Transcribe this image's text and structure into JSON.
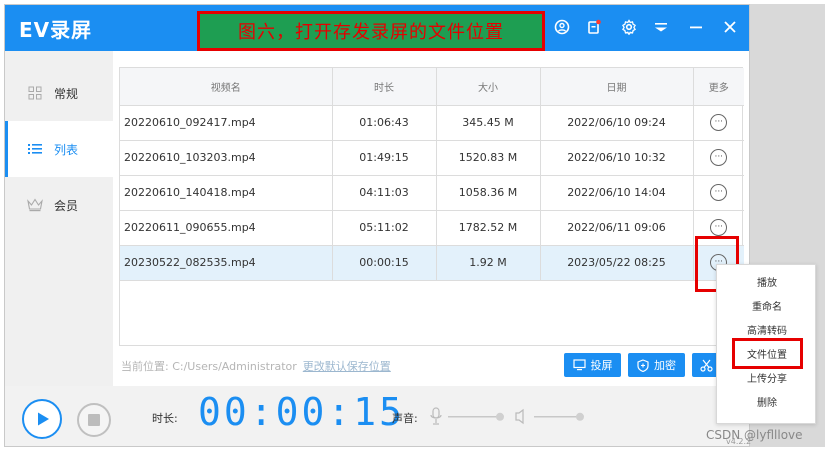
{
  "app": {
    "title": "EV录屏"
  },
  "annotation": {
    "title": "图六，打开存发录屏的文件位置"
  },
  "sidebar": {
    "items": [
      {
        "label": "常规"
      },
      {
        "label": "列表"
      },
      {
        "label": "会员"
      }
    ]
  },
  "table": {
    "headers": [
      "视频名",
      "时长",
      "大小",
      "日期",
      "更多"
    ],
    "rows": [
      {
        "name": "20220610_092417.mp4",
        "duration": "01:06:43",
        "size": "345.45 M",
        "date": "2022/06/10 09:24"
      },
      {
        "name": "20220610_103203.mp4",
        "duration": "01:49:15",
        "size": "1520.83 M",
        "date": "2022/06/10 10:32"
      },
      {
        "name": "20220610_140418.mp4",
        "duration": "04:11:03",
        "size": "1058.36 M",
        "date": "2022/06/10 14:04"
      },
      {
        "name": "20220611_090655.mp4",
        "duration": "05:11:02",
        "size": "1782.52 M",
        "date": "2022/06/11 09:06"
      },
      {
        "name": "20230522_082535.mp4",
        "duration": "00:00:15",
        "size": "1.92 M",
        "date": "2023/05/22 08:25"
      }
    ]
  },
  "path": {
    "label": "当前位置: C:/Users/Administrator",
    "change_link": "更改默认保存位置"
  },
  "buttons": {
    "cast": "投屏",
    "encrypt": "加密"
  },
  "bottom": {
    "duration_label": "时长:",
    "timer": "00:00:15",
    "volume_label": "声音:"
  },
  "context_menu": {
    "items": [
      "播放",
      "重命名",
      "高清转码",
      "文件位置",
      "上传分享",
      "删除"
    ]
  },
  "watermark": "CSDN @lyflllove",
  "version": "v4.2.2",
  "colors": {
    "accent": "#1b8ef2",
    "annotation_bg": "#1e9e52",
    "annotation_red": "#e60000"
  }
}
